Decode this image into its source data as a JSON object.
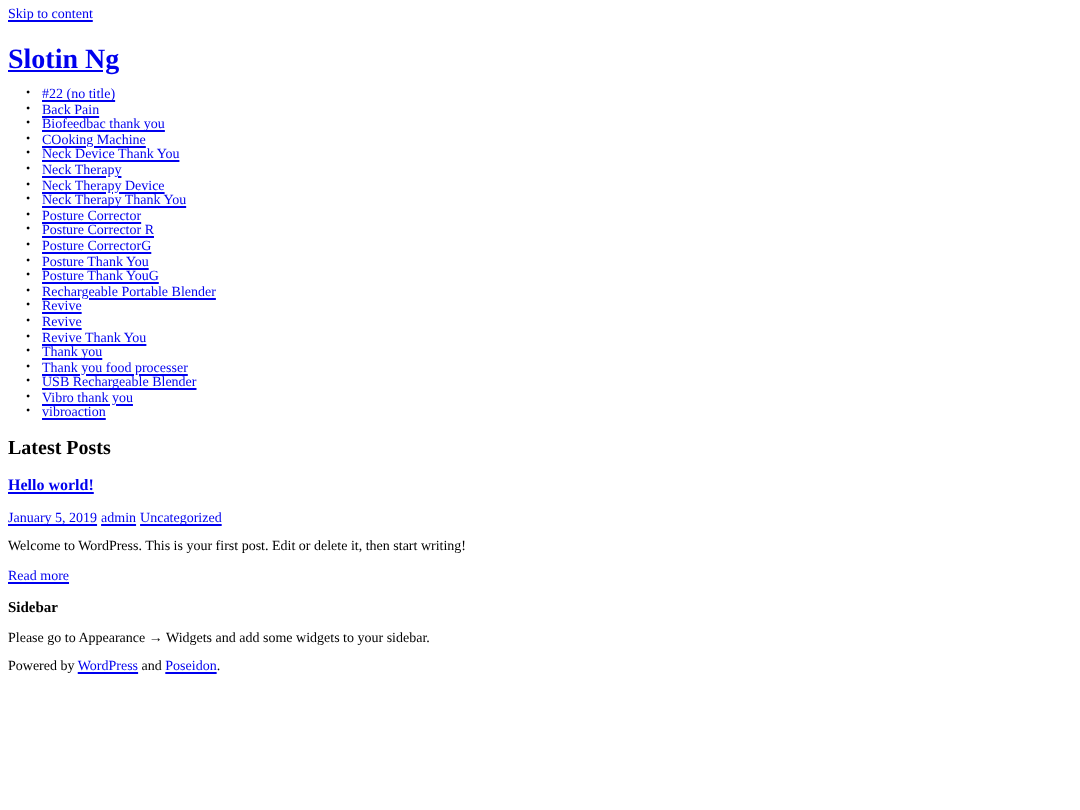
{
  "skip_link": "Skip to content",
  "site_title": "Slotin Ng",
  "pages": [
    {
      "bullet": "•",
      "label": "#22 (no title)"
    },
    {
      "bullet": "•",
      "label": "Back Pain"
    },
    {
      "bullet": "•",
      "label": "Biofeedbac thank you"
    },
    {
      "bullet": "•",
      "label": "COoking Machine"
    },
    {
      "bullet": "•",
      "label": "Neck Device Thank You"
    },
    {
      "bullet": "•",
      "label": "Neck Therapy"
    },
    {
      "bullet": "•",
      "label": "Neck Therapy Device"
    },
    {
      "bullet": "•",
      "label": "Neck Therapy Thank You"
    },
    {
      "bullet": "•",
      "label": "Posture Corrector"
    },
    {
      "bullet": "•",
      "label": "Posture Corrector R"
    },
    {
      "bullet": "•",
      "label": "Posture CorrectorG"
    },
    {
      "bullet": "•",
      "label": "Posture Thank You"
    },
    {
      "bullet": "•",
      "label": "Posture Thank YouG"
    },
    {
      "bullet": "•",
      "label": "Rechargeable Portable Blender"
    },
    {
      "bullet": "•",
      "label": "Revive"
    },
    {
      "bullet": "•",
      "label": "Revive"
    },
    {
      "bullet": "•",
      "label": "Revive Thank You"
    },
    {
      "bullet": "•",
      "label": "Thank you"
    },
    {
      "bullet": "•",
      "label": "Thank you food processer"
    },
    {
      "bullet": "•",
      "label": "USB Rechargeable Blender"
    },
    {
      "bullet": "•",
      "label": "Vibro thank you"
    },
    {
      "bullet": "•",
      "label": "vibroaction"
    }
  ],
  "latest_heading": "Latest Posts",
  "post": {
    "title": "Hello world!",
    "date": "January 5, 2019",
    "author": "admin",
    "category": "Uncategorized",
    "excerpt": "Welcome to WordPress. This is your first post. Edit or delete it, then start writing!",
    "read_more": "Read more"
  },
  "sidebar": {
    "heading": "Sidebar",
    "text": "Please go to Appearance → Widgets and add some widgets to your sidebar."
  },
  "footer": {
    "prefix": "Powered by",
    "link1": "WordPress",
    "joiner": "and",
    "link2": "Poseidon",
    "suffix": "."
  }
}
